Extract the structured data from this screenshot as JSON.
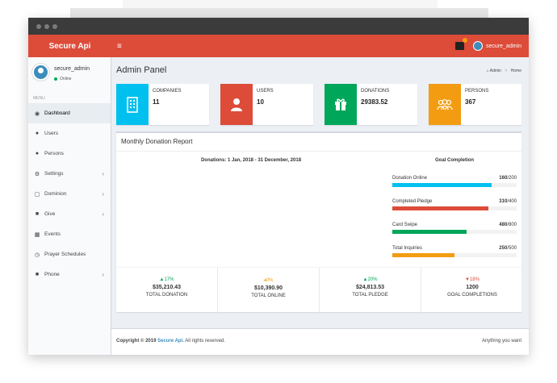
{
  "window": {
    "dots": [
      "",
      "",
      ""
    ]
  },
  "topbar": {
    "logo": "Secure Api",
    "menu_toggle": "≡",
    "notification_badge": "",
    "user": "secure_admin"
  },
  "sidebar": {
    "user": {
      "name": "secure_admin",
      "status": "Online"
    },
    "menu_header": "MENU",
    "items": [
      {
        "label": "Dashboard",
        "icon": "dashboard-icon",
        "active": true
      },
      {
        "label": "Users",
        "icon": "user-icon"
      },
      {
        "label": "Persons",
        "icon": "persons-icon"
      },
      {
        "label": "Settings",
        "icon": "gear-icon",
        "has_children": true
      },
      {
        "label": "Dominion",
        "icon": "file-icon",
        "has_children": true
      },
      {
        "label": "Give",
        "icon": "gift-icon",
        "has_children": true
      },
      {
        "label": "Events",
        "icon": "calendar-icon"
      },
      {
        "label": "Prayer Schedules",
        "icon": "clock-icon"
      },
      {
        "label": "Phone",
        "icon": "phone-icon",
        "has_children": true
      }
    ]
  },
  "header": {
    "title": "Admin Panel",
    "breadcrumb": [
      "Admin",
      "Home"
    ]
  },
  "info_boxes": [
    {
      "label": "COMPANIES",
      "value": "11",
      "color": "#00c0ef",
      "icon": "building-icon"
    },
    {
      "label": "USERS",
      "value": "10",
      "color": "#dd4b39",
      "icon": "user-icon"
    },
    {
      "label": "DONATIONS",
      "value": "29383.52",
      "color": "#00a65a",
      "icon": "gift-icon"
    },
    {
      "label": "PERSONS",
      "value": "367",
      "color": "#f39c12",
      "icon": "people-icon"
    }
  ],
  "report": {
    "title": "Monthly Donation Report",
    "chart_caption": "Donations: 1 Jan, 2018 - 31 December, 2018",
    "goal_title": "Goal Completion",
    "goals": [
      {
        "label": "Donation Online",
        "current": "160",
        "total": "/200",
        "fraction": 0.8,
        "color": "#00c0ef"
      },
      {
        "label": "Completed Pledge",
        "current": "310",
        "total": "/400",
        "fraction": 0.775,
        "color": "#dd4b39"
      },
      {
        "label": "Card Swipe",
        "current": "480",
        "total": "/800",
        "fraction": 0.6,
        "color": "#00a65a"
      },
      {
        "label": "Total Inquiries",
        "current": "250",
        "total": "/500",
        "fraction": 0.5,
        "color": "#f39c12"
      }
    ],
    "stats": [
      {
        "pct": "▲17%",
        "amount": "$35,210.43",
        "label": "TOTAL DONATION",
        "color": "#00a65a"
      },
      {
        "pct": "◂0%",
        "amount": "$10,390.90",
        "label": "TOTAL ONLINE",
        "color": "#f39c12"
      },
      {
        "pct": "▲20%",
        "amount": "$24,813.53",
        "label": "TOTAL PLEDGE",
        "color": "#00a65a"
      },
      {
        "pct": "▼18%",
        "amount": "1200",
        "label": "GOAL COMPLETIONS",
        "color": "#dd4b39"
      }
    ]
  },
  "footer": {
    "copyright_prefix": "Copyright © 2019",
    "brand": "Secure Api.",
    "rights": "All rights reserved.",
    "tagline": "Anything you want"
  }
}
